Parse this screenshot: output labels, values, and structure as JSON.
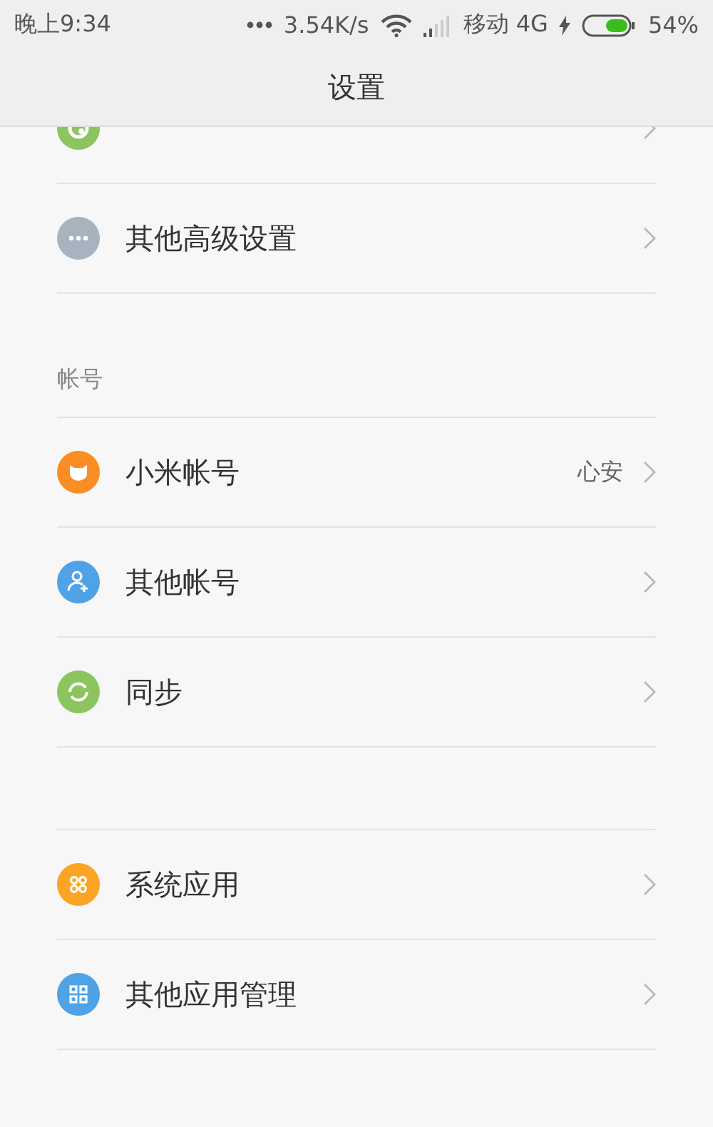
{
  "status_bar": {
    "time": "晚上9:34",
    "speed": "3.54K/s",
    "carrier": "移动 4G",
    "battery": "54%"
  },
  "header": {
    "title": "设置"
  },
  "sections": [
    {
      "items": [
        {
          "kind": "kid"
        },
        {
          "kind": "more",
          "label": "其他高级设置"
        }
      ]
    },
    {
      "title": "帐号",
      "items": [
        {
          "kind": "mi",
          "label": "小米帐号",
          "value": "心安"
        },
        {
          "kind": "person",
          "label": "其他帐号"
        },
        {
          "kind": "sync",
          "label": "同步"
        }
      ]
    },
    {
      "items": [
        {
          "kind": "apps",
          "label": "系统应用"
        },
        {
          "kind": "grid",
          "label": "其他应用管理"
        }
      ]
    }
  ]
}
